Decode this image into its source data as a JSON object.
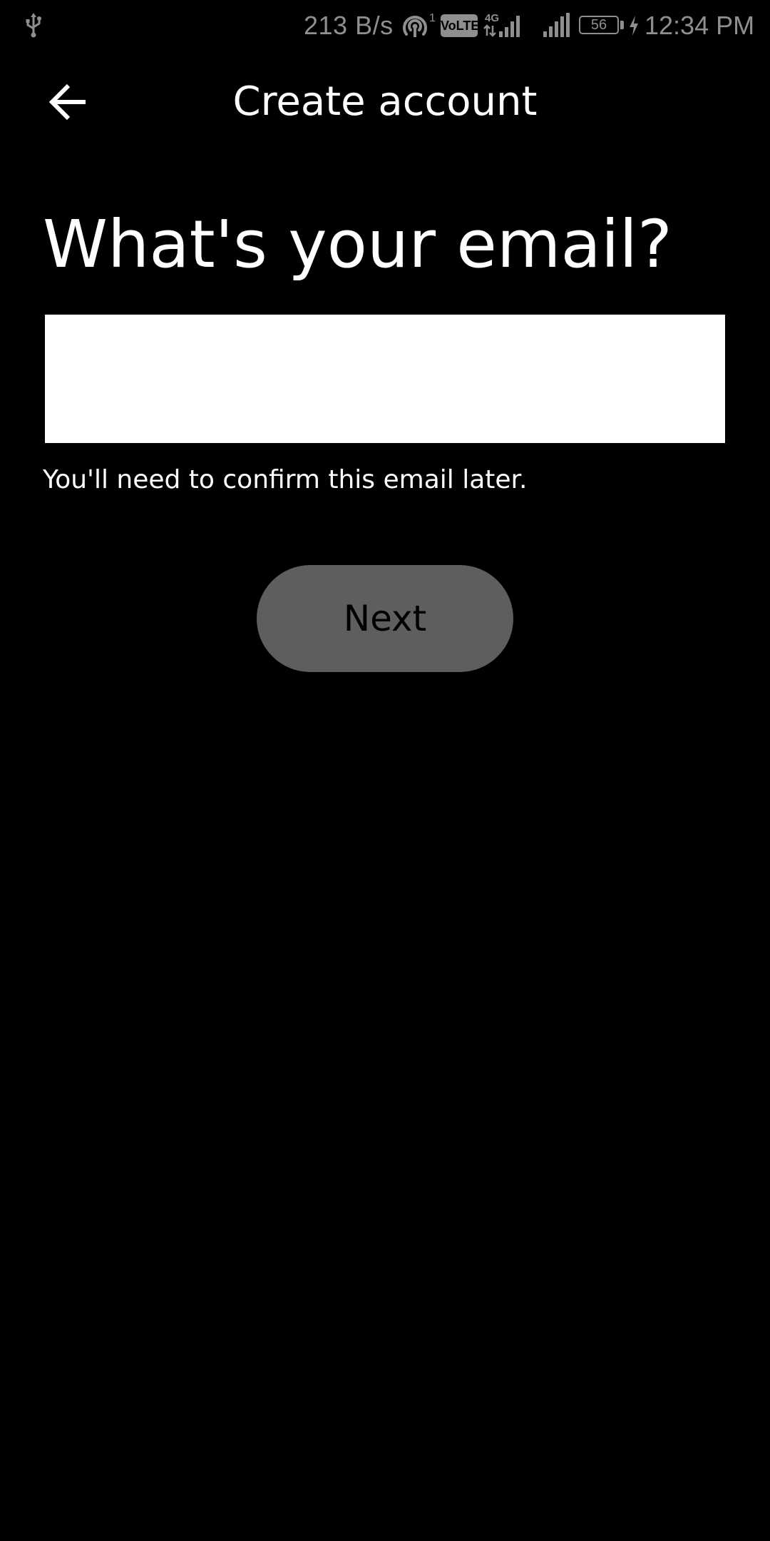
{
  "status_bar": {
    "net_speed": "213 B/s",
    "hotspot_count": "1",
    "volte_label": "VoLTE",
    "network_type": "4G",
    "battery_level": "56",
    "time": "12:34 PM",
    "icons": [
      "usb-icon",
      "hotspot-icon",
      "volte-icon",
      "signal-4g-icon",
      "signal-icon",
      "battery-icon",
      "charging-icon"
    ]
  },
  "toolbar": {
    "back_icon": "arrow-left-icon",
    "title": "Create account"
  },
  "form": {
    "heading": "What's your email?",
    "email_value": "",
    "email_placeholder": "",
    "helper_text": "You'll need to confirm this email later.",
    "next_label": "Next"
  },
  "colors": {
    "background": "#000000",
    "text": "#ffffff",
    "input_background": "#ffffff",
    "button_disabled": "#5e5e5e",
    "status_text": "#8f8f8f"
  }
}
